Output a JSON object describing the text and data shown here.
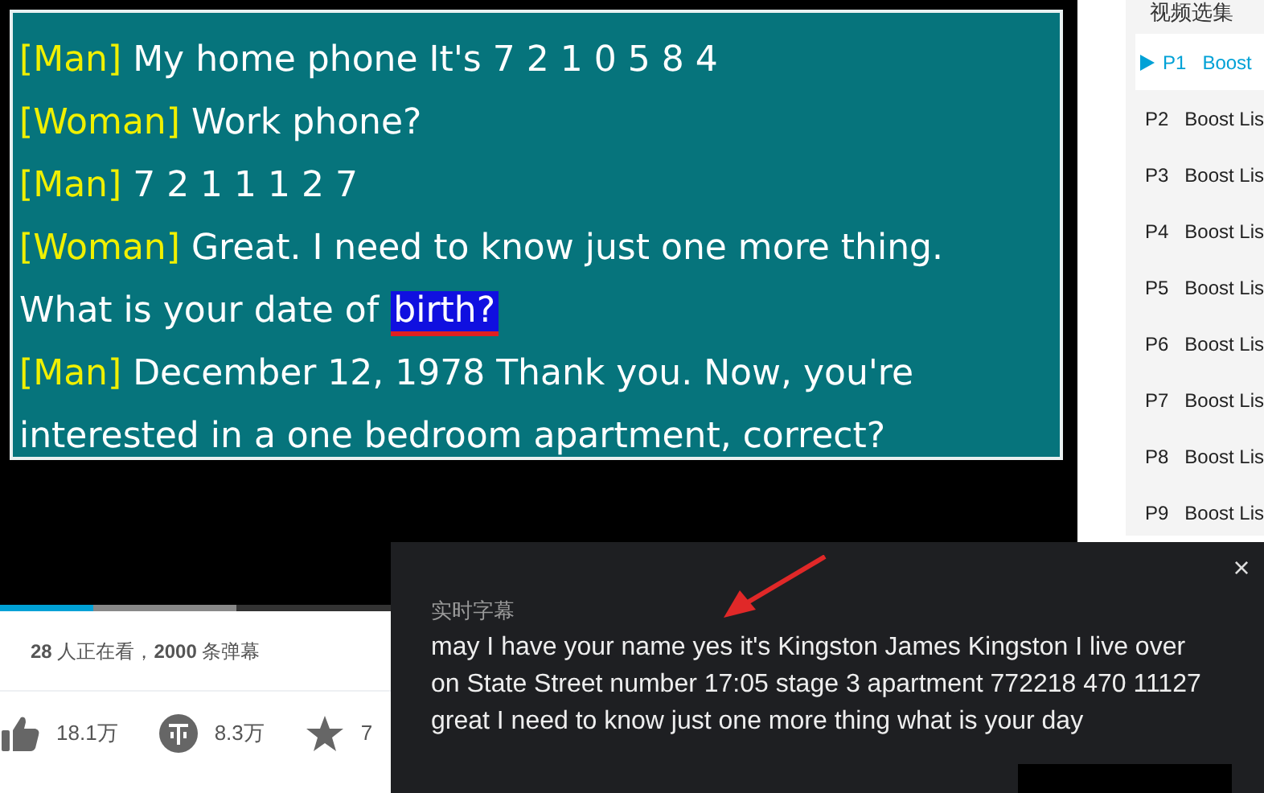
{
  "video": {
    "lines": [
      {
        "speaker": "[Man]",
        "text": "My home phone It's 7 2 1 0 5 8 4"
      },
      {
        "speaker": "[Woman]",
        "text": "Work phone?"
      },
      {
        "speaker": "[Man]",
        "text": "7 2 1 1 1 2 7"
      },
      {
        "speaker": "[Woman]",
        "text": "Great. I need to know just one more thing."
      },
      {
        "text": "What is your date of",
        "highlight": "birth?"
      },
      {
        "speaker": "[Man]",
        "text": "December 12, 1978 Thank you. Now, you're"
      },
      {
        "text": "interested in a one bedroom apartment, correct?"
      }
    ]
  },
  "progress_bar": {
    "level": 0.087
  },
  "buffer_bar": {
    "level": 0.22
  },
  "stats": "**28** 人正在看，**2000** 条弹幕",
  "actions": [
    {
      "kind": "like",
      "count": "18.1万"
    },
    {
      "kind": "coin",
      "count": "8.3万"
    },
    {
      "kind": "favorite",
      "count": "7"
    }
  ],
  "sidebar": {
    "title": "视频选集",
    "episodes": [
      {
        "index": "P1",
        "title": "Boost",
        "selected": true
      },
      {
        "index": "P2",
        "title": "Boost Lis",
        "selected": false
      },
      {
        "index": "P3",
        "title": "Boost Lis",
        "selected": false
      },
      {
        "index": "P4",
        "title": "Boost Lis",
        "selected": false
      },
      {
        "index": "P5",
        "title": "Boost Lis",
        "selected": false
      },
      {
        "index": "P6",
        "title": "Boost Lis",
        "selected": false
      },
      {
        "index": "P7",
        "title": "Boost Lis",
        "selected": false
      },
      {
        "index": "P8",
        "title": "Boost Lis",
        "selected": false
      },
      {
        "index": "P9",
        "title": "Boost Lis",
        "selected": false
      }
    ]
  },
  "caption_popup": {
    "title": "实时字幕",
    "close": "×",
    "text": "may I have your name yes it's Kingston James Kingston I live over on State Street number 17:05 stage 3 apartment 772218 470 11127 great I need to know just one more thing what is your day"
  }
}
